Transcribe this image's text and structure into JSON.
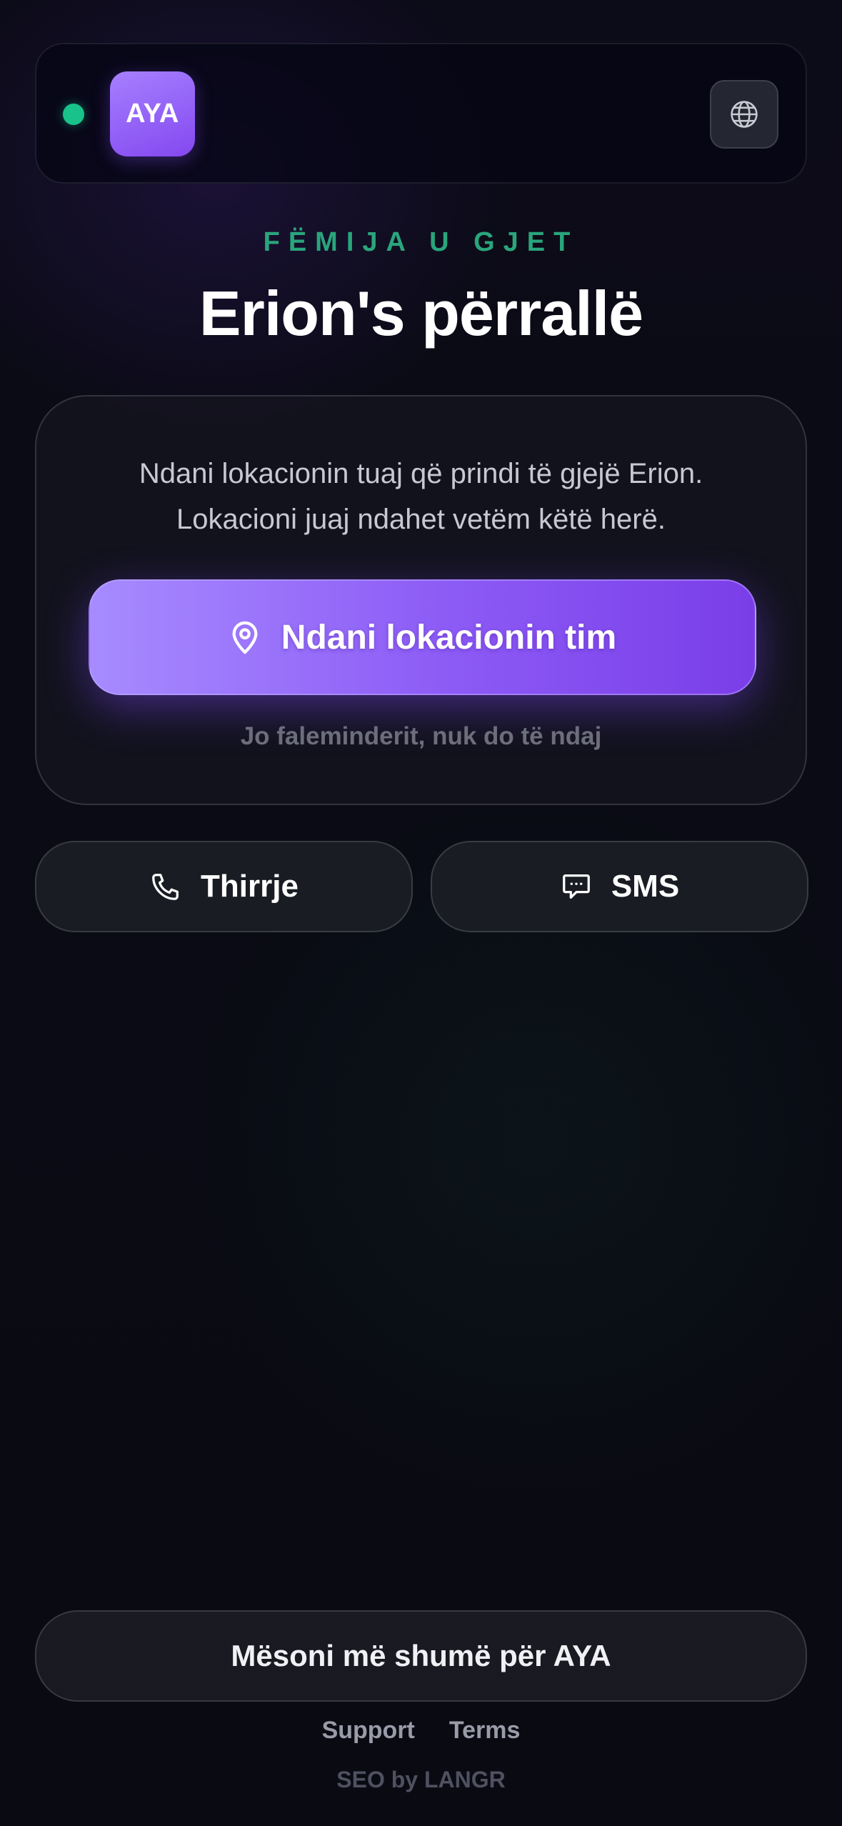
{
  "header": {
    "logo_text": "AYA",
    "language_icon": "globe-icon",
    "status_color": "#19c28a"
  },
  "hero": {
    "eyebrow": "FËMIJA U GJET",
    "title": "Erion's përrallë"
  },
  "card": {
    "line1": "Ndani lokacionin tuaj që prindi të gjejë Erion.",
    "line2": "Lokacioni juaj ndahet vetëm këtë herë.",
    "share_icon": "map-pin-icon",
    "share_label": "Ndani lokacionin tim",
    "decline_label": "Jo faleminderit, nuk do të ndaj"
  },
  "contact": {
    "call_icon": "phone-icon",
    "call_label": "Thirrje",
    "sms_icon": "chat-bubble-icon",
    "sms_label": "SMS"
  },
  "footer": {
    "learn_more": "Mësoni më shumë për AYA",
    "links": [
      "Support",
      "Terms"
    ],
    "seo": "SEO by LANGR"
  },
  "colors": {
    "accent": "#8c5af5",
    "eyebrow": "#2aa57c",
    "background": "#0b0b14"
  }
}
